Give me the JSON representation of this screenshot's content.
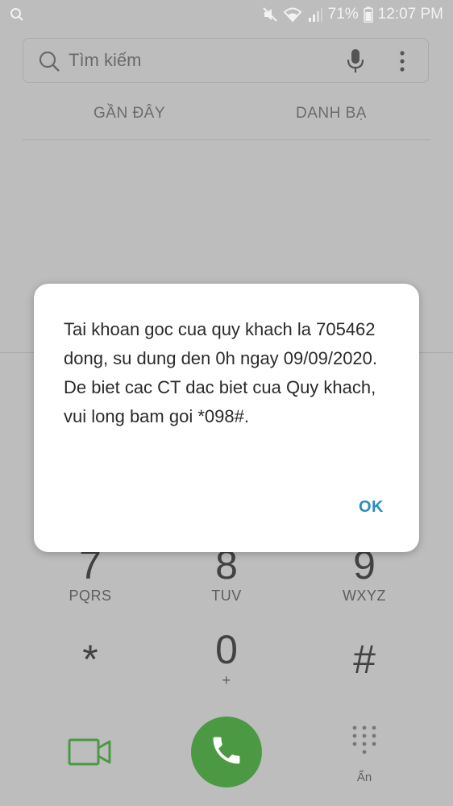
{
  "status_bar": {
    "battery": "71%",
    "time": "12:07 PM",
    "icons": [
      "search-icon",
      "mute-icon",
      "wifi-icon",
      "signal-icon",
      "battery-icon"
    ]
  },
  "search": {
    "placeholder": "Tìm kiếm"
  },
  "tabs": [
    {
      "label": "GẦN ĐÂY"
    },
    {
      "label": "DANH BẠ"
    }
  ],
  "keypad": {
    "keys": [
      {
        "digit": "7",
        "letters": "PQRS"
      },
      {
        "digit": "8",
        "letters": "TUV"
      },
      {
        "digit": "9",
        "letters": "WXYZ"
      },
      {
        "digit": "*",
        "letters": ""
      },
      {
        "digit": "0",
        "letters": "+"
      },
      {
        "digit": "#",
        "letters": ""
      }
    ]
  },
  "bottom_bar": {
    "hide_label": "Ẩn",
    "call_color": "#4b9a43",
    "video_color": "#4b9a43"
  },
  "dialog": {
    "message": "Tai khoan goc cua quy khach la 705462 dong, su dung den 0h ngay 09/09/2020. De biet cac CT dac biet cua Quy khach, vui long bam goi *098#.",
    "ok_label": "OK",
    "accent_color": "#2b8cbe"
  }
}
